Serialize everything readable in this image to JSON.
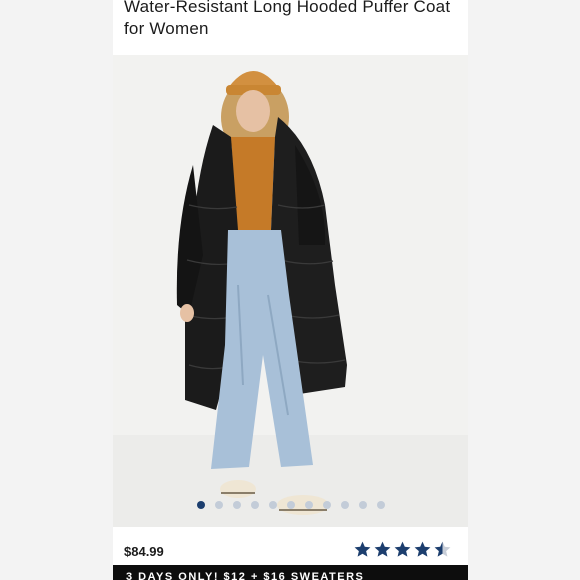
{
  "product": {
    "title": "Water-Resistant Long Hooded Puffer Coat for Women",
    "image_icon": "product-photo-coat",
    "price": "$84.99",
    "rating": 4.5,
    "rating_max": 5
  },
  "carousel": {
    "count": 11,
    "active_index": 0
  },
  "promo": {
    "text": "3 DAYS ONLY! $12 + $16 SWEATERS"
  },
  "colors": {
    "accent_navy": "#1c3e6e",
    "star": "#1c3e6e",
    "dot_inactive": "#c3ccd8",
    "promo_bg": "#0d0d0d"
  }
}
